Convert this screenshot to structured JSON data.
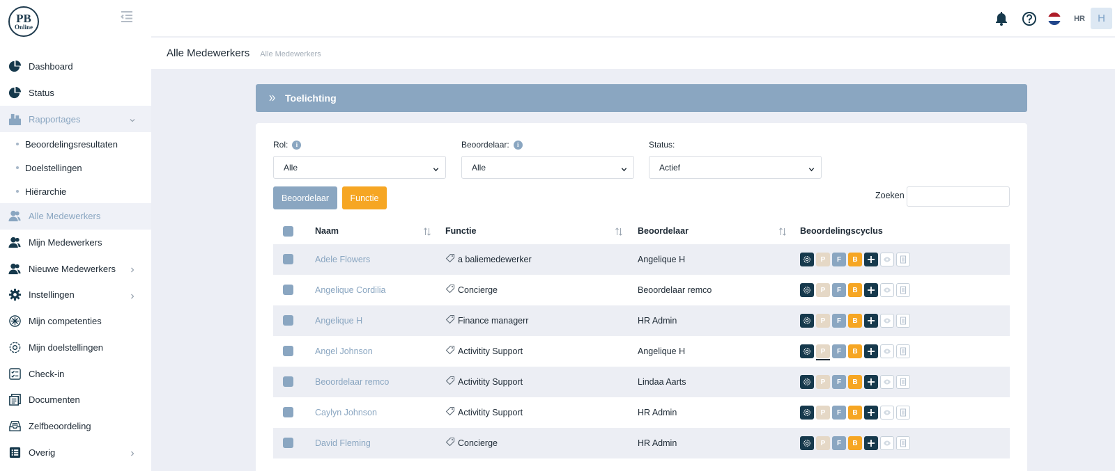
{
  "logo": {
    "line1": "PB",
    "line2": "Online"
  },
  "sidebar": {
    "items": [
      {
        "label": "Dashboard"
      },
      {
        "label": "Status"
      },
      {
        "label": "Rapportages"
      },
      {
        "label": "Beoordelingsresultaten"
      },
      {
        "label": "Doelstellingen"
      },
      {
        "label": "Hiërarchie"
      },
      {
        "label": "Alle Medewerkers"
      },
      {
        "label": "Mijn Medewerkers"
      },
      {
        "label": "Nieuwe Medewerkers"
      },
      {
        "label": "Instellingen"
      },
      {
        "label": "Mijn competenties"
      },
      {
        "label": "Mijn doelstellingen"
      },
      {
        "label": "Check-in"
      },
      {
        "label": "Documenten"
      },
      {
        "label": "Zelfbeoordeling"
      },
      {
        "label": "Overig"
      }
    ]
  },
  "topbar": {
    "role": "HR",
    "avatar": "H"
  },
  "header": {
    "title": "Alle Medewerkers",
    "breadcrumb": "Alle Medewerkers"
  },
  "toelichting": {
    "label": "Toelichting"
  },
  "filters": {
    "rol": {
      "label": "Rol:",
      "value": "Alle"
    },
    "beoordelaar": {
      "label": "Beoordelaar:",
      "value": "Alle"
    },
    "status": {
      "label": "Status:",
      "value": "Actief"
    }
  },
  "buttons": {
    "beoordelaar": "Beoordelaar",
    "functie": "Functie"
  },
  "search": {
    "label": "Zoeken",
    "value": ""
  },
  "table": {
    "columns": {
      "naam": "Naam",
      "functie": "Functie",
      "beoordelaar": "Beoordelaar",
      "cyclus": "Beoordelingscyclus"
    },
    "cycle_labels": {
      "p": "P",
      "f": "F",
      "b": "B"
    },
    "rows": [
      {
        "naam": "Adele Flowers",
        "functie": "a baliemedewerker",
        "beoordelaar": "Angelique H"
      },
      {
        "naam": "Angelique Cordilia",
        "functie": "Concierge",
        "beoordelaar": "Beoordelaar remco"
      },
      {
        "naam": "Angelique H",
        "functie": "Finance managerr",
        "beoordelaar": "HR Admin"
      },
      {
        "naam": "Angel Johnson",
        "functie": "Activitity Support",
        "beoordelaar": "Angelique H"
      },
      {
        "naam": "Beoordelaar remco",
        "functie": "Activitity Support",
        "beoordelaar": "Lindaa Aarts"
      },
      {
        "naam": "Caylyn Johnson",
        "functie": "Activitity Support",
        "beoordelaar": "HR Admin"
      },
      {
        "naam": "David Fleming",
        "functie": "Concierge",
        "beoordelaar": "HR Admin"
      }
    ]
  },
  "colors": {
    "accent": "#8aa6c1",
    "orange": "#f6a623",
    "dark": "#16394c",
    "beige": "#e5d8c6"
  }
}
